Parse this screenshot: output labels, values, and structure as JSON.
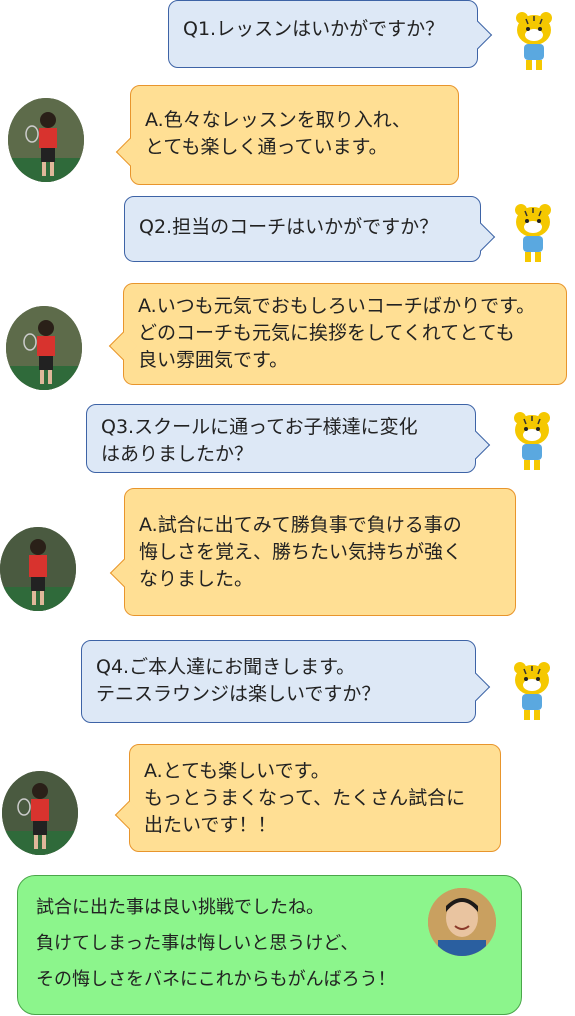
{
  "conversation": [
    {
      "id": "q1",
      "text": "Q1.レッスンはいかがですか？"
    },
    {
      "id": "a1",
      "text": "A.色々なレッスンを取り入れ、\nとても楽しく通っています。"
    },
    {
      "id": "q2",
      "text": "Q2.担当のコーチはいかがですか？"
    },
    {
      "id": "a2",
      "text": "A.いつも元気でおもしろいコーチばかりです。\nどのコーチも元気に挨拶をしてくれてとても\n良い雰囲気です。"
    },
    {
      "id": "q3",
      "text": "Q3.スクールに通ってお子様達に変化\nはありましたか？"
    },
    {
      "id": "a3",
      "text": "A.試合に出てみて勝負事で負ける事の\n悔しさを覚え、勝ちたい気持ちが強く\nなりました。"
    },
    {
      "id": "q4",
      "text": "Q4.ご本人達にお聞きします。\nテニスラウンジは楽しいですか？"
    },
    {
      "id": "a4",
      "text": "A.とても楽しいです。\nもっとうまくなって、たくさん試合に\n出たいです！！"
    }
  ],
  "coach_comment": {
    "lines": [
      "試合に出た事は良い挑戦でしたね。",
      "負けてしまった事は悔しいと思うけど、",
      "その悔しさをバネにこれからもがんばろう！"
    ]
  },
  "colors": {
    "question_bg": "#dde8f6",
    "question_border": "#3d63a6",
    "answer_bg": "#ffdf94",
    "answer_border": "#e8952c",
    "coach_bg": "#8cf58c",
    "coach_border": "#4aa64a"
  }
}
